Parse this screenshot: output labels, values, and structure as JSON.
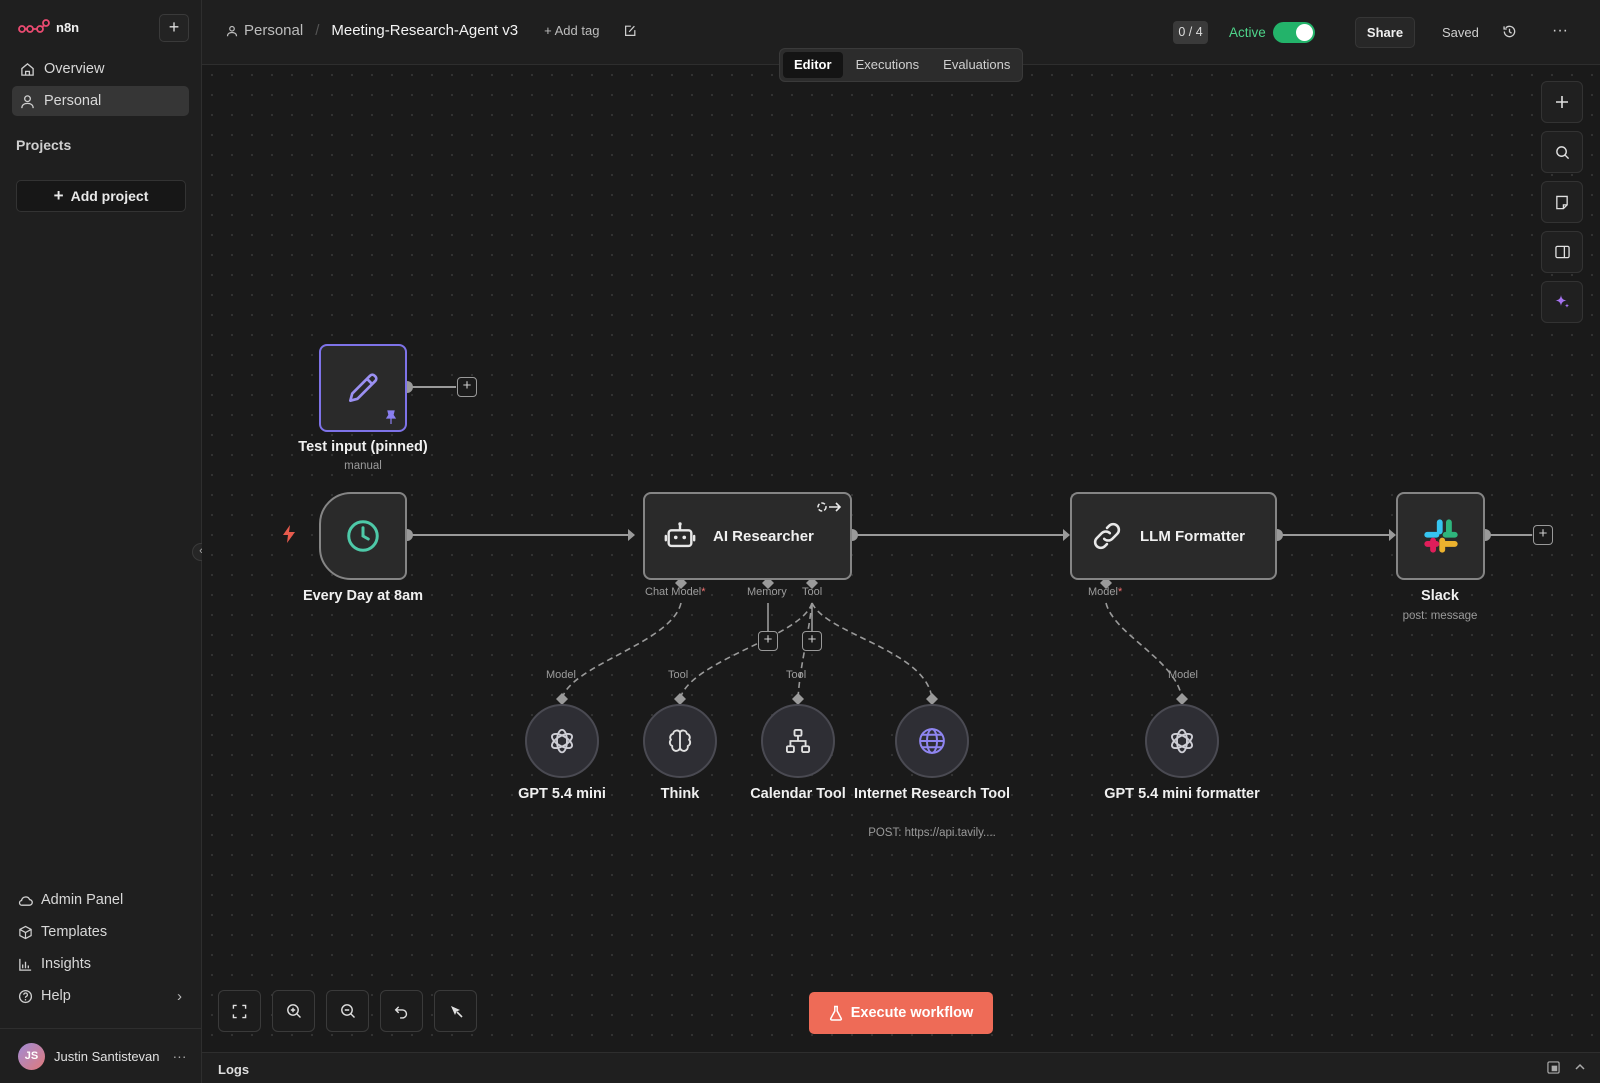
{
  "app": {
    "name": "n8n"
  },
  "sidebar": {
    "new_label": "+",
    "nav": [
      {
        "label": "Overview"
      },
      {
        "label": "Personal"
      }
    ],
    "projects_label": "Projects",
    "add_project_label": "Add project",
    "bottom": [
      {
        "label": "Admin Panel"
      },
      {
        "label": "Templates"
      },
      {
        "label": "Insights"
      },
      {
        "label": "Help"
      }
    ],
    "user": {
      "initials": "JS",
      "name": "Justin Santistevan"
    }
  },
  "header": {
    "project": "Personal",
    "separator": "/",
    "workflow_name": "Meeting-Research-Agent v3",
    "add_tag": "+ Add tag",
    "progress": "0 / 4",
    "active_label": "Active",
    "active": true,
    "share_label": "Share",
    "saved_label": "Saved",
    "more_label": "···"
  },
  "tabs": [
    {
      "label": "Editor",
      "active": true
    },
    {
      "label": "Executions",
      "active": false
    },
    {
      "label": "Evaluations",
      "active": false
    }
  ],
  "nodes": {
    "test_input": {
      "title": "Test input (pinned)",
      "subtitle": "manual"
    },
    "schedule": {
      "title": "Every Day at 8am"
    },
    "ai_researcher": {
      "title": "AI Researcher",
      "ports": {
        "chat_model": "Chat Model",
        "memory": "Memory",
        "tool": "Tool",
        "required_mark": "*"
      }
    },
    "llm_formatter": {
      "title": "LLM Formatter",
      "ports": {
        "model": "Model",
        "required_mark": "*"
      }
    },
    "slack": {
      "title": "Slack",
      "subtitle": "post: message"
    },
    "gpt_mini": {
      "title": "GPT 5.4 mini",
      "port": "Model"
    },
    "think": {
      "title": "Think",
      "port": "Tool"
    },
    "calendar": {
      "title": "Calendar Tool",
      "port": "Tool"
    },
    "internet": {
      "title": "Internet Research Tool",
      "subtitle": "POST: https://api.tavily...."
    },
    "gpt_formatter": {
      "title": "GPT 5.4 mini formatter",
      "port": "Model"
    }
  },
  "execute_label": "Execute workflow",
  "logs_label": "Logs",
  "colors": {
    "accent": "#ee6b57",
    "active_green": "#23b36a",
    "pinned_purple": "#7e73e8",
    "schedule_teal": "#4ec9a8"
  },
  "icons": {
    "overview": "home-icon",
    "personal": "user-icon",
    "admin": "cloud-icon",
    "templates": "package-icon",
    "insights": "bar-chart-icon",
    "help": "help-circle-icon"
  }
}
